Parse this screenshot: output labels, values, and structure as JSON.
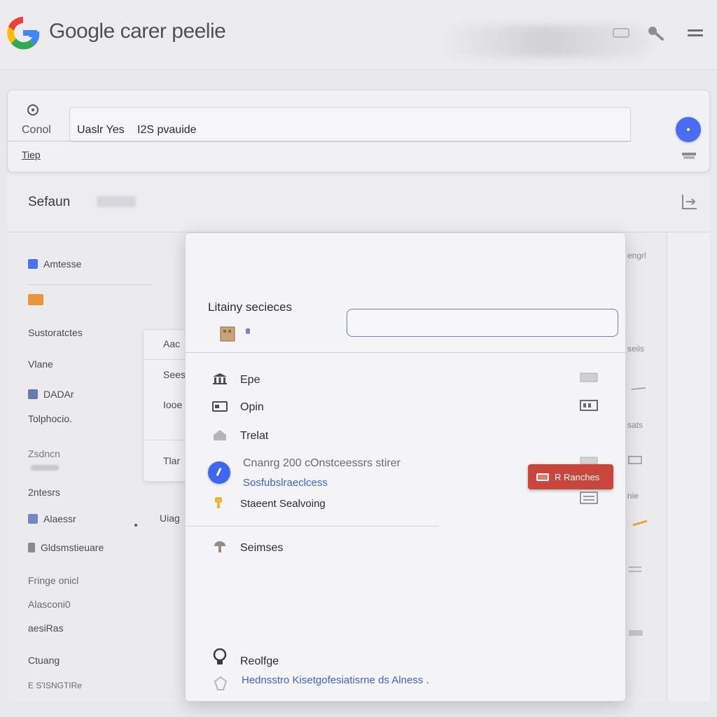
{
  "app": {
    "logo_text": "Google carer peelie"
  },
  "search": {
    "left_label": "Conol",
    "bar_text_a": "Uaslr Yes",
    "bar_text_b": "I2S pvauide",
    "second_row": "Tiep"
  },
  "section": {
    "title": "Sefaun"
  },
  "sidebar": {
    "items": [
      {
        "label": "Amtesse",
        "icon": "folder-blue-icon",
        "top": 0
      },
      {
        "label": "",
        "icon": "orange-tag-icon"
      },
      {
        "label": "Sustoratctes"
      },
      {
        "label": "Vlane"
      },
      {
        "label": "DADAr",
        "icon": "person-icon"
      },
      {
        "label": "Tolphocio."
      },
      {
        "label": "Zsdncn"
      },
      {
        "label": "2ntesrs"
      },
      {
        "label": "Alaessr",
        "icon": "image-icon"
      },
      {
        "label": "Gldsmstieuare",
        "icon": "doc-icon"
      },
      {
        "label": "Fringe onicl"
      },
      {
        "label": "Alasconi0"
      },
      {
        "label": "aesiRas"
      },
      {
        "label": "Ctuang"
      },
      {
        "label": "E S'ISNGTIRe"
      }
    ]
  },
  "ghost_panel": {
    "items": [
      "Aac",
      "Sees",
      "Iooe",
      "Tlar"
    ],
    "side_text": "Uiag"
  },
  "right_faint": [
    "engrl",
    "seiis",
    "sats",
    "nie"
  ],
  "modal": {
    "heading": "Litainy secieces",
    "input_value": "",
    "rows": [
      {
        "label": "Epe",
        "icon": "bank-icon"
      },
      {
        "label": "Opin",
        "icon": "card-icon"
      },
      {
        "label": "Trelat",
        "icon": "home-icon"
      }
    ],
    "grey_line": "Cnanrg 200 cOnstceessrs stirer",
    "blue_link": "Sosfubslraeclcess",
    "row_key": {
      "label": "Staeent Sealvoing",
      "icon": "key-icon"
    },
    "row_services": {
      "label": "Seimses",
      "icon": "mushroom-icon"
    },
    "row_reolfge": {
      "label": "Reolfge",
      "icon": "bulb-icon"
    },
    "bottom_link": "Hednsstro Kisetgofesiatisrne ds Alness ."
  },
  "red_button": {
    "label": "R Ranches"
  },
  "colors": {
    "accent_blue": "#4a6cf0",
    "link_blue": "#3d63d6",
    "button_red": "#c8463c",
    "input_border": "#6b7ee0"
  }
}
